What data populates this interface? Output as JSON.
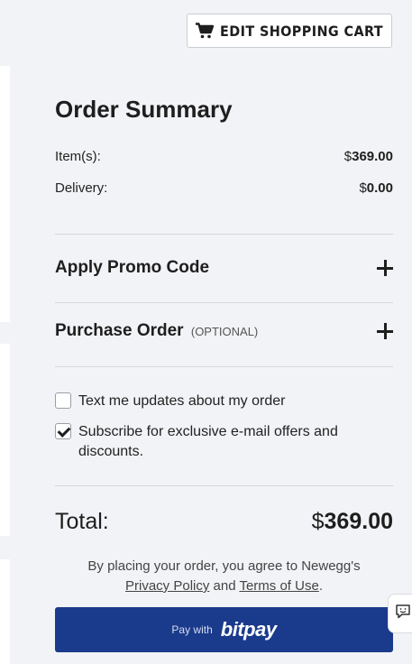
{
  "header": {
    "edit_cart_label": "EDIT SHOPPING CART",
    "edit_cart_icon": "shopping-cart-icon"
  },
  "summary": {
    "title": "Order Summary",
    "lines": [
      {
        "label": "Item(s):",
        "currency": "$",
        "amount": "369.00"
      },
      {
        "label": "Delivery:",
        "currency": "$",
        "amount": "0.00"
      }
    ],
    "promo": {
      "label": "Apply Promo Code",
      "icon": "plus-icon"
    },
    "purchase_order": {
      "label": "Purchase Order",
      "optional": "(OPTIONAL)",
      "icon": "plus-icon"
    },
    "options": [
      {
        "label": "Text me updates about my order",
        "checked": false
      },
      {
        "label": "Subscribe for exclusive e-mail offers and discounts.",
        "checked": true
      }
    ],
    "total": {
      "label": "Total:",
      "currency": "$",
      "amount": "369.00"
    },
    "legal": {
      "prefix": "By placing your order, you agree to Newegg's",
      "privacy": "Privacy Policy",
      "and": "and",
      "terms": "Terms of Use",
      "suffix": "."
    },
    "pay_button": {
      "prefix": "Pay with",
      "brand": "bitpay"
    }
  },
  "feedback": {
    "icon": "feedback-chat-icon"
  },
  "colors": {
    "background": "#f2f3f6",
    "pay_button": "#1a3a8b",
    "text": "#1e1e1e",
    "divider": "#d5d7dc"
  }
}
